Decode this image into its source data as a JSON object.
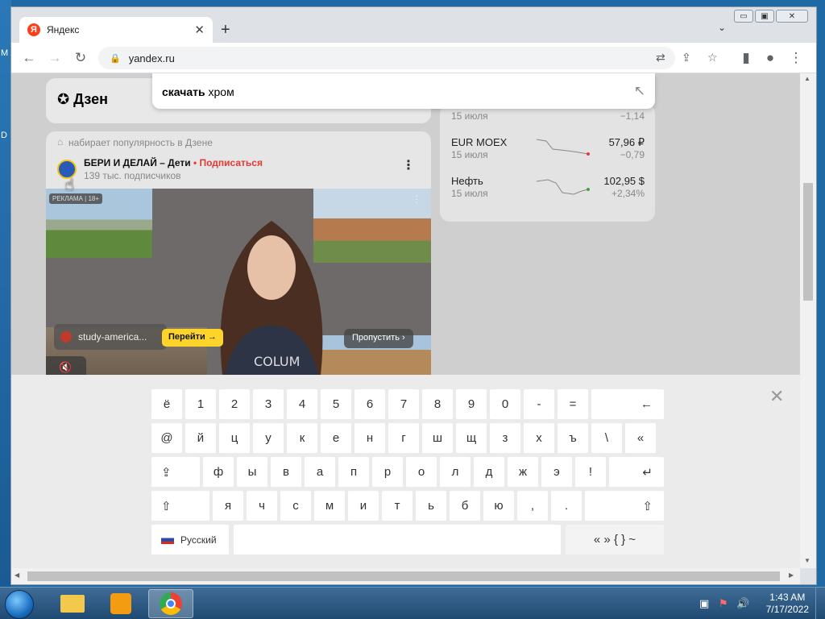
{
  "desktop": {
    "edge_labels": [
      "M",
      "D"
    ]
  },
  "window_controls": {
    "minimize": "▭",
    "restore": "▣",
    "close": "✕"
  },
  "tab": {
    "favicon_letter": "Я",
    "title": "Яндекс",
    "close": "✕"
  },
  "new_tab": "+",
  "tab_dropdown": "⌄",
  "toolbar": {
    "url": "yandex.ru"
  },
  "dzen": {
    "logo": "✪ Дзен"
  },
  "search": {
    "query_bold": "скачать",
    "query_rest": " хром",
    "arrow": "↖"
  },
  "finance": [
    {
      "name": "",
      "date": "15 июля",
      "value": "",
      "change": "−1,14"
    },
    {
      "name": "EUR MOEX",
      "date": "15 июля",
      "value": "57,96 ₽",
      "change": "−0,79"
    },
    {
      "name": "Нефть",
      "date": "15 июля",
      "value": "102,95 $",
      "change": "+2,34%"
    }
  ],
  "post": {
    "hint": "набирает популярность в Дзене",
    "channel": "БЕРИ И ДЕЛАЙ – Дети",
    "subscribe": " • Подписаться",
    "subscribers": "139 тыс. подписчиков",
    "more": "⋮",
    "ad_badge": "РЕКЛАМА | 18+",
    "advertiser": "study-america...",
    "go_button": "Перейти →",
    "skip_button": "Пропустить ›",
    "mute": "🔇"
  },
  "keyboard": {
    "close": "✕",
    "row1": [
      "ё",
      "1",
      "2",
      "3",
      "4",
      "5",
      "6",
      "7",
      "8",
      "9",
      "0",
      "-",
      "="
    ],
    "backspace": "←",
    "row2": [
      "@",
      "й",
      "ц",
      "у",
      "к",
      "е",
      "н",
      "г",
      "ш",
      "щ",
      "з",
      "х",
      "ъ",
      "\\",
      "«"
    ],
    "caps": "⇪",
    "row3": [
      "ф",
      "ы",
      "в",
      "а",
      "п",
      "р",
      "о",
      "л",
      "д",
      "ж",
      "э",
      "!"
    ],
    "enter": "↵",
    "shift": "⇧",
    "row4": [
      "я",
      "ч",
      "с",
      "м",
      "и",
      "т",
      "ь",
      "б",
      "ю",
      ",",
      "."
    ],
    "shift_right": "⇧",
    "language": "Русский",
    "symbols": "« » { } ~"
  },
  "taskbar": {
    "time": "1:43 AM",
    "date": "7/17/2022"
  }
}
